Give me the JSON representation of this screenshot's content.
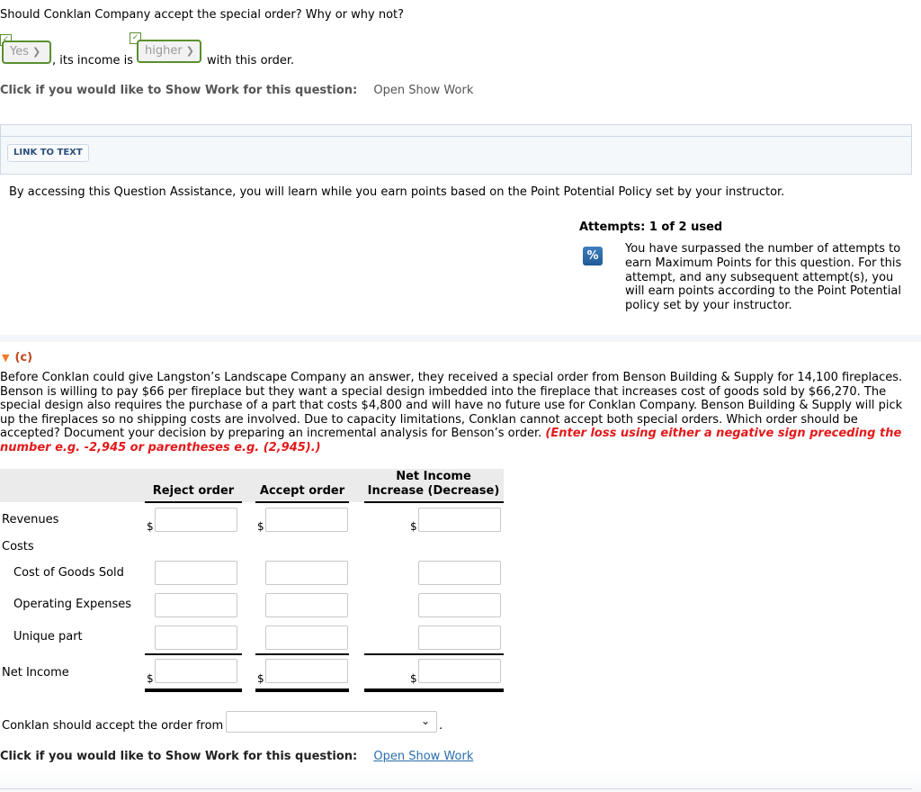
{
  "part_b": {
    "question": "Should Conklan Company accept the special order? Why or why not?",
    "answer1": {
      "value": "Yes",
      "correct": true
    },
    "mid_text": ", its income is",
    "answer2": {
      "value": "higher",
      "correct": true
    },
    "end_text": "with this order.",
    "show_work_prompt": "Click if you would like to Show Work for this question:",
    "show_work_link": "Open Show Work"
  },
  "resources": {
    "link_to_text": "LINK TO TEXT"
  },
  "assistance": {
    "notice": "By accessing this Question Assistance, you will learn while you earn points based on the Point Potential Policy set by your instructor.",
    "attempts_label": "Attempts: 1 of 2 used",
    "percent_icon": "%",
    "attempts_message": "You have surpassed the number of attempts to earn Maximum Points for this question. For this attempt, and any subsequent attempt(s), you will earn points according to the Point Potential policy set by your instructor."
  },
  "part_c": {
    "label": "(c)",
    "problem_text": "Before Conklan could give Langston’s Landscape Company an answer, they received a special order from Benson Building & Supply for 14,100 fireplaces. Benson is willing to pay $66 per fireplace but they want a special design imbedded into the fireplace that increases cost of goods sold by $66,270. The special design also requires the purchase of a part that costs $4,800 and will have no future use for Conklan Company. Benson Building & Supply will pick up the fireplaces so no shipping costs are involved. Due to capacity limitations, Conklan cannot accept both special orders. Which order should be accepted? Document your decision by preparing an incremental analysis for Benson’s order.",
    "instruction": "(Enter loss using either a negative sign preceding the number e.g. -2,945 or parentheses e.g. (2,945).)",
    "table": {
      "columns": [
        "Reject order",
        "Accept order",
        "Net Income Increase (Decrease)"
      ],
      "col3_line1": "Net Income",
      "col3_line2": "Increase (Decrease)",
      "currency_symbol": "$",
      "rows": [
        {
          "label": "Revenues",
          "values": [
            "",
            "",
            ""
          ]
        },
        {
          "label": "Costs"
        },
        {
          "label": "Cost of Goods Sold",
          "values": [
            "",
            "",
            ""
          ]
        },
        {
          "label": "Operating Expenses",
          "values": [
            "",
            "",
            ""
          ]
        },
        {
          "label": "Unique part",
          "values": [
            "",
            "",
            ""
          ]
        },
        {
          "label": "Net Income",
          "values": [
            "",
            "",
            ""
          ]
        }
      ]
    },
    "conclusion_prefix": "Conklan should accept the order from",
    "conclusion_value": "",
    "conclusion_suffix": ".",
    "show_work_prompt": "Click if you would like to Show Work for this question:",
    "show_work_link": "Open Show Work"
  },
  "colors": {
    "correct_green": "#5b8f2e",
    "instruction_red": "#e3191b",
    "section_orange": "#c0461a",
    "link_blue": "#2a6eab"
  }
}
